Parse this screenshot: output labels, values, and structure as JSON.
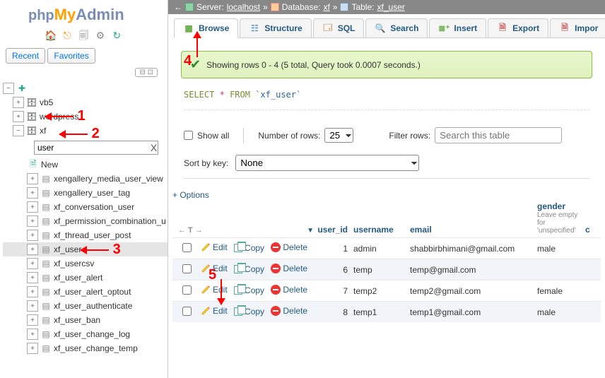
{
  "logo": {
    "php": "php",
    "my": "My",
    "admin": "Admin"
  },
  "nav": {
    "recent": "Recent",
    "favorites": "Favorites"
  },
  "tree": {
    "new": "New",
    "db_vb5": "vb5",
    "db_wp": "wordpress",
    "db_xf": "xf",
    "filter": "user",
    "tables": [
      "xengallery_media_user_view",
      "xengallery_user_tag",
      "xf_conversation_user",
      "xf_permission_combination_u",
      "xf_thread_user_post",
      "xf_user",
      "xf_usercsv",
      "xf_user_alert",
      "xf_user_alert_optout",
      "xf_user_authenticate",
      "xf_user_ban",
      "xf_user_change_log",
      "xf_user_change_temp"
    ]
  },
  "annotations": {
    "a1": "1",
    "a2": "2",
    "a3": "3",
    "a4": "4",
    "a5": "5"
  },
  "breadcrumb": {
    "server_lbl": "Server:",
    "server": "localhost",
    "db_lbl": "Database:",
    "db": "xf",
    "table_lbl": "Table:",
    "table": "xf_user"
  },
  "tabs": {
    "browse": "Browse",
    "structure": "Structure",
    "sql": "SQL",
    "search": "Search",
    "insert": "Insert",
    "export": "Export",
    "import": "Impor"
  },
  "notice": "Showing rows 0 - 4 (5 total, Query took 0.0007 seconds.)",
  "query": {
    "select": "SELECT",
    "star": "*",
    "from": "FROM",
    "table": "`xf_user`"
  },
  "controls": {
    "show_all": "Show all",
    "num_rows": "Number of rows:",
    "num_rows_val": "25",
    "filter_lbl": "Filter rows:",
    "filter_ph": "Search this table"
  },
  "sort": {
    "label": "Sort by key:",
    "value": "None"
  },
  "options": "+ Options",
  "headers": {
    "user_id": "user_id",
    "username": "username",
    "email": "email",
    "gender": "gender",
    "gender_sub": "Leave empty for 'unspecified'",
    "c": "c"
  },
  "actions": {
    "edit": "Edit",
    "copy": "Copy",
    "delete": "Delete"
  },
  "rows": [
    {
      "id": "1",
      "username": "admin",
      "email": "shabbirbhimani@gmail.com",
      "gender": "male"
    },
    {
      "id": "6",
      "username": "temp",
      "email": "temp@gmail.com",
      "gender": ""
    },
    {
      "id": "7",
      "username": "temp2",
      "email": "temp2@gmail.com",
      "gender": "female"
    },
    {
      "id": "8",
      "username": "temp1",
      "email": "temp1@gmail.com",
      "gender": "male"
    }
  ]
}
